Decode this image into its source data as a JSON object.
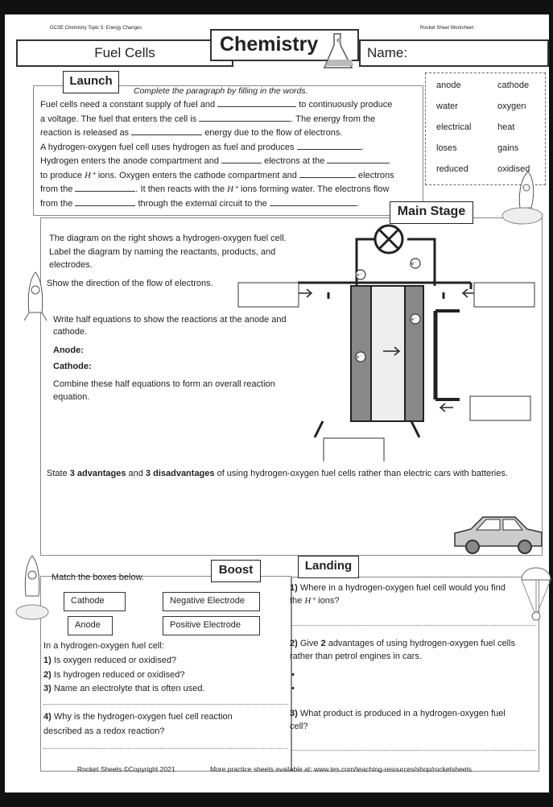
{
  "header": {
    "topic": "GCSE Chemistry Topic 5: Energy Changes",
    "series": "Rocket Sheet Worksheet",
    "subject": "Chemistry",
    "title": "Fuel Cells",
    "name_label": "Name:"
  },
  "launch": {
    "label": "Launch",
    "instruction": "Complete the paragraph by filling in the words.",
    "lines": [
      "Fuel cells need a constant supply of fuel and",
      "to continuously produce",
      "a voltage. The fuel that enters the cell is",
      ". The energy from the",
      "reaction is released as",
      "energy due to the flow of electrons.",
      "A hydrogen-oxygen fuel cell uses hydrogen as fuel and produces",
      ".",
      "Hydrogen enters the anode compartment and",
      "electrons at the",
      "to produce",
      "ions. Oxygen enters the cathode compartment and",
      "electrons",
      "from the",
      ". It then reacts with the",
      "ions forming water. The electrons flow",
      "from the",
      "through the external circuit to the",
      "."
    ],
    "hplus": "H⁺",
    "word_bank": [
      "anode",
      "cathode",
      "water",
      "oxygen",
      "electrical",
      "heat",
      "loses",
      "gains",
      "reduced",
      "oxidised"
    ]
  },
  "main": {
    "label": "Main Stage",
    "p1": "The diagram on the right shows a hydrogen-oxygen fuel cell.",
    "p2": "Label the diagram by naming the reactants, products, and",
    "p3": "electrodes.",
    "p4": "Show the direction of the flow of electrons.",
    "p5": "Write half equations to show the reactions at the anode and",
    "p6": "cathode.",
    "anode": "Anode:",
    "cathode": "Cathode:",
    "p7": "Combine these half equations to form an overall reaction",
    "p8": "equation.",
    "electron": "e⁻",
    "q_pre": "State ",
    "q_b1": "3 advantages",
    "q_mid": " and ",
    "q_b2": "3 disadvantages",
    "q_post": " of using hydrogen-oxygen fuel cells rather than electric cars with batteries."
  },
  "boost": {
    "label": "Boost",
    "instruction": "Match the boxes below.",
    "left": [
      "Cathode",
      "Anode"
    ],
    "right": [
      "Negative Electrode",
      "Positive Electrode"
    ],
    "intro": "In a hydrogen-oxygen fuel cell:",
    "q": [
      {
        "n": "1)",
        "t": " Is oxygen reduced or oxidised?"
      },
      {
        "n": "2)",
        "t": " Is hydrogen reduced or oxidised?"
      },
      {
        "n": "3)",
        "t": " Name an electrolyte that is often used."
      },
      {
        "n": "4)",
        "t": " Why is the hydrogen-oxygen fuel cell reaction"
      }
    ],
    "q4b": "described as a redox reaction?"
  },
  "landing": {
    "label": "Landing",
    "q1n": "1)",
    "q1a": " Where in a hydrogen-oxygen fuel cell would you find",
    "q1b": "the",
    "q1c": " ions?",
    "q2n": "2)",
    "q2a": " Give ",
    "q2b": "2",
    "q2c": " advantages of using hydrogen-oxygen fuel cells",
    "q2d": "rather than petrol engines in cars.",
    "bullet": "•",
    "q3n": "3)",
    "q3a": " What product is produced in a hydrogen-oxygen fuel",
    "q3b": "cell?"
  },
  "footer": {
    "copyright": "Rocket Sheets ©Copyright 2021",
    "more": "More practice sheets available at: www.tes.com/teaching-resources/shop/rocketsheets"
  }
}
